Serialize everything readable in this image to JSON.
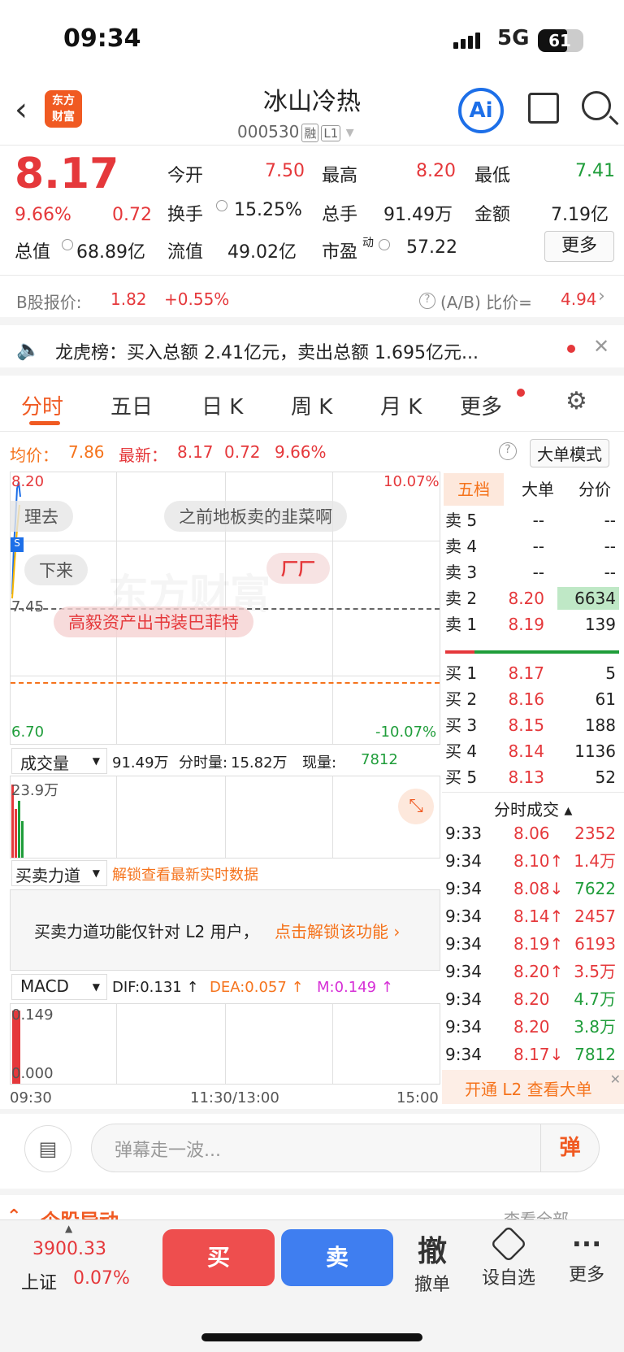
{
  "status": {
    "time": "09:34",
    "network": "5G",
    "battery": "61"
  },
  "nav": {
    "logo_line1": "东方",
    "logo_line2": "财富",
    "title": "冰山冷热",
    "code": "000530",
    "tag1": "融",
    "tag2": "L1",
    "ai": "Ai"
  },
  "quote": {
    "price": "8.17",
    "pct": "9.66%",
    "chg": "0.72",
    "open_label": "今开",
    "open": "7.50",
    "high_label": "最高",
    "high": "8.20",
    "low_label": "最低",
    "low": "7.41",
    "turnover_label": "换手",
    "turnover": "15.25%",
    "vol_label": "总手",
    "vol": "91.49万",
    "amt_label": "金额",
    "amt": "7.19亿",
    "mcap_label": "总值",
    "mcap": "68.89亿",
    "fmcap_label": "流值",
    "fmcap": "49.02亿",
    "pe_label": "市盈",
    "pe_sup": "动",
    "pe": "57.22",
    "more": "更多"
  },
  "bshare": {
    "label": "B股报价:",
    "price": "1.82",
    "pct": "+0.55%",
    "ratio_label": "(A/B) 比价=",
    "ratio": "4.94"
  },
  "notice": {
    "text": "龙虎榜：买入总额 2.41亿元，卖出总额 1.695亿元..."
  },
  "tabs": [
    "分时",
    "五日",
    "日 K",
    "周 K",
    "月 K",
    "更多"
  ],
  "chart_info": {
    "avg_label": "均价：",
    "avg": "7.86",
    "latest_label": "最新：",
    "latest": "8.17",
    "chg": "0.72",
    "pct": "9.66%",
    "mode": "大单模式"
  },
  "chart_axis": {
    "top": "8.20",
    "mid": "7.45",
    "bottom": "6.70",
    "top_pct": "10.07%",
    "bottom_pct": "-10.07%",
    "t0": "09:30",
    "t1": "11:30/13:00",
    "t2": "15:00"
  },
  "danmaku": [
    "理去",
    "之前地板卖的韭菜啊",
    "下来",
    "厂厂",
    "高毅资产出书装巴菲特"
  ],
  "watermark": "东方财富",
  "volume": {
    "label": "成交量",
    "total": "91.49万",
    "fen_label": "分时量:",
    "fen": "15.82万",
    "now_label": "现量:",
    "now": "7812",
    "max": "23.9万"
  },
  "force": {
    "label": "买卖力道",
    "link": "解锁查看最新实时数据",
    "notice": "买卖力道功能仅针对 L2 用户，",
    "cta": "点击解锁该功能"
  },
  "macd": {
    "label": "MACD",
    "dif": "DIF:0.131 ↑",
    "dea": "DEA:0.057 ↑",
    "m": "M:0.149 ↑",
    "top": "0.149",
    "bottom": "0.000"
  },
  "depth_tabs": [
    "五档",
    "大单",
    "分价"
  ],
  "asks": [
    {
      "l": "卖 5",
      "p": "--",
      "v": "--"
    },
    {
      "l": "卖 4",
      "p": "--",
      "v": "--"
    },
    {
      "l": "卖 3",
      "p": "--",
      "v": "--"
    },
    {
      "l": "卖 2",
      "p": "8.20",
      "v": "6634"
    },
    {
      "l": "卖 1",
      "p": "8.19",
      "v": "139"
    }
  ],
  "bids": [
    {
      "l": "买 1",
      "p": "8.17",
      "v": "5"
    },
    {
      "l": "买 2",
      "p": "8.16",
      "v": "61"
    },
    {
      "l": "买 3",
      "p": "8.15",
      "v": "188"
    },
    {
      "l": "买 4",
      "p": "8.14",
      "v": "1136"
    },
    {
      "l": "买 5",
      "p": "8.13",
      "v": "52"
    }
  ],
  "trades_title": "分时成交",
  "trades": [
    {
      "t": "9:33",
      "p": "8.06",
      "v": "2352",
      "pc": "red",
      "vc": "red"
    },
    {
      "t": "9:34",
      "p": "8.10↑",
      "v": "1.4万",
      "pc": "red",
      "vc": "red"
    },
    {
      "t": "9:34",
      "p": "8.08↓",
      "v": "7622",
      "pc": "red",
      "vc": "green"
    },
    {
      "t": "9:34",
      "p": "8.14↑",
      "v": "2457",
      "pc": "red",
      "vc": "red"
    },
    {
      "t": "9:34",
      "p": "8.19↑",
      "v": "6193",
      "pc": "red",
      "vc": "red"
    },
    {
      "t": "9:34",
      "p": "8.20↑",
      "v": "3.5万",
      "pc": "red",
      "vc": "red"
    },
    {
      "t": "9:34",
      "p": "8.20",
      "v": "4.7万",
      "pc": "red",
      "vc": "green"
    },
    {
      "t": "9:34",
      "p": "8.20",
      "v": "3.8万",
      "pc": "red",
      "vc": "green"
    },
    {
      "t": "9:34",
      "p": "8.17↓",
      "v": "7812",
      "pc": "red",
      "vc": "green"
    }
  ],
  "l2_banner": "开通 L2 查看大单",
  "comment": {
    "placeholder": "弹幕走一波...",
    "send": "弹"
  },
  "section": {
    "title": "个股异动",
    "more": "查看全部"
  },
  "bottom": {
    "index": "3900.33",
    "index_name": "上证",
    "index_pct": "0.07%",
    "buy": "买",
    "sell": "卖",
    "cancel_icon": "撤",
    "cancel": "撤单",
    "fav": "设自选",
    "more": "更多"
  }
}
